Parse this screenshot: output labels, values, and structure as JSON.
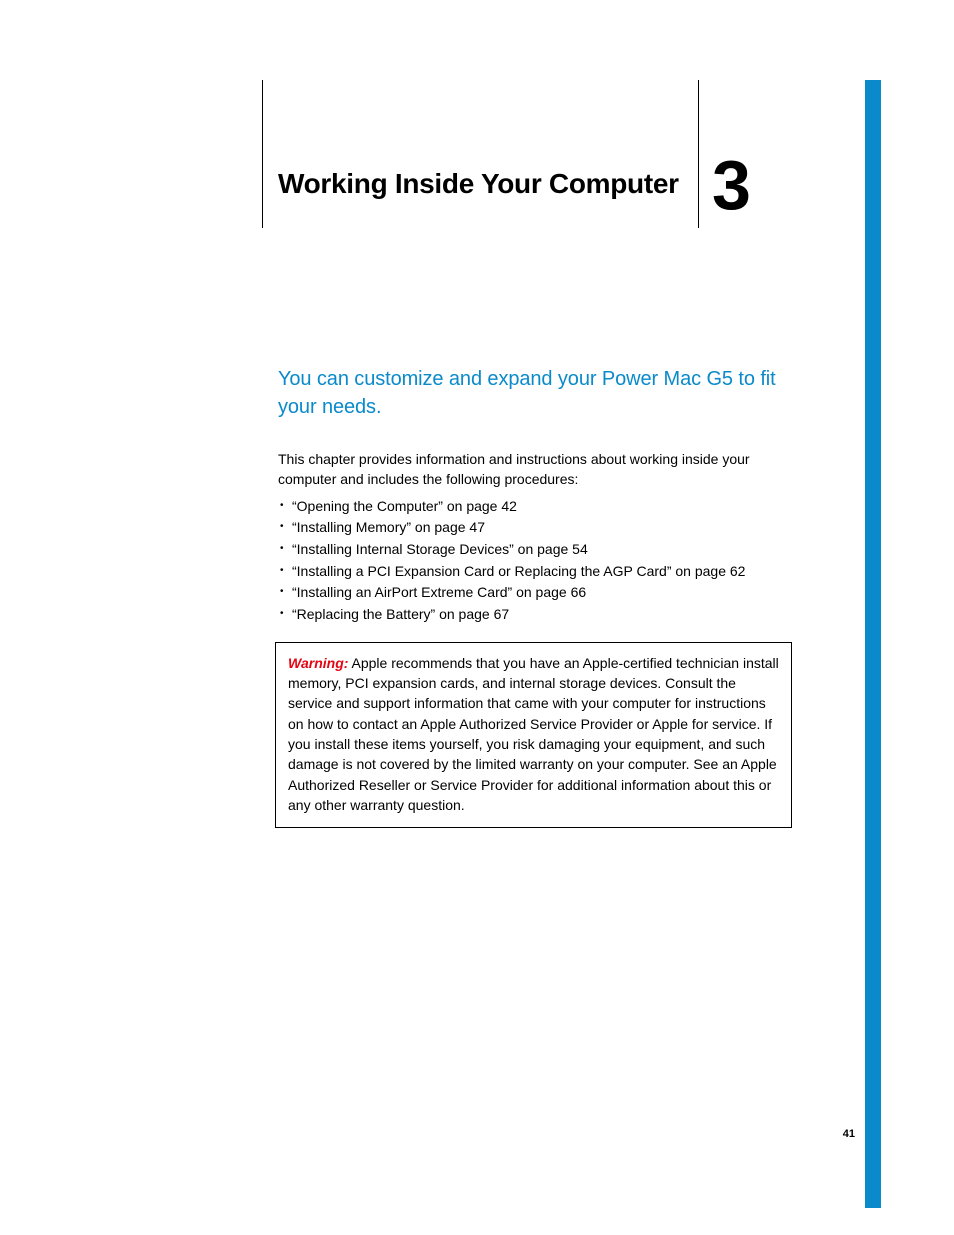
{
  "chapter": {
    "title": "Working Inside Your Computer",
    "number": "3"
  },
  "intro": {
    "heading": "You can customize and expand your Power Mac G5 to fit your needs.",
    "paragraph": "This chapter provides information and instructions about working inside your computer and includes the following procedures:"
  },
  "procedures": [
    "“Opening the Computer” on page 42",
    "“Installing Memory” on page 47",
    "“Installing Internal Storage Devices” on page 54",
    "“Installing a PCI Expansion Card or Replacing the AGP Card” on page 62",
    "“Installing an AirPort Extreme Card” on page 66",
    "“Replacing the Battery” on page 67"
  ],
  "warning": {
    "label": "Warning:",
    "text": " Apple recommends that you have an Apple-certified technician install memory, PCI expansion cards, and internal storage devices. Consult the service and support information that came with your computer for instructions on how to contact an Apple Authorized Service Provider or Apple for service. If you install these items yourself, you risk damaging your equipment, and such damage is not covered by the limited warranty on your computer. See an Apple Authorized Reseller or Service Provider for additional information about this or any other warranty question."
  },
  "page_number": "41"
}
